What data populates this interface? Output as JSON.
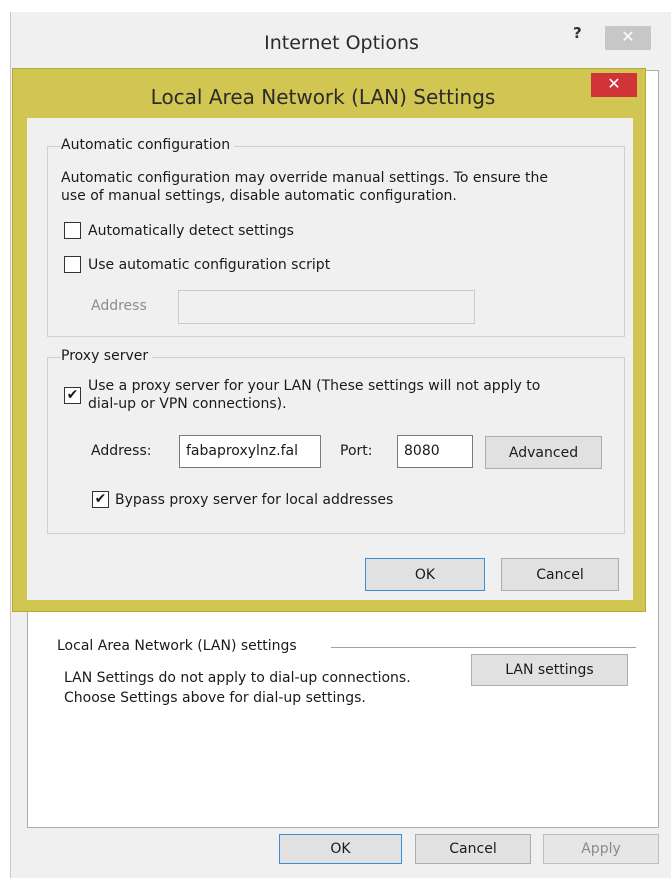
{
  "outer_window": {
    "title": "Internet Options",
    "help_label": "?",
    "close_glyph": "✕",
    "lan_group_label": "Local Area Network (LAN) settings",
    "lan_desc_line1": "LAN Settings do not apply to dial-up connections.",
    "lan_desc_line2": "Choose Settings above for dial-up settings.",
    "lan_settings_button": "LAN settings",
    "ok_button": "OK",
    "cancel_button": "Cancel",
    "apply_button": "Apply"
  },
  "lan_dialog": {
    "title": "Local Area Network (LAN) Settings",
    "close_glyph": "✕",
    "accent_color": "#d2c652",
    "automatic": {
      "group_label": "Automatic configuration",
      "description_line1": "Automatic configuration may override manual settings.  To ensure the",
      "description_line2": "use of manual settings, disable automatic configuration.",
      "detect_label": "Automatically detect settings",
      "detect_checked": false,
      "script_label": "Use automatic configuration script",
      "script_checked": false,
      "address_label": "Address",
      "address_value": ""
    },
    "proxy": {
      "group_label": "Proxy server",
      "use_proxy_label_line1": "Use a proxy server for your LAN (These settings will not apply to",
      "use_proxy_label_line2": "dial-up or VPN connections).",
      "use_proxy_checked": true,
      "address_label": "Address:",
      "address_value": "fabaproxylnz.fal",
      "port_label": "Port:",
      "port_value": "8080",
      "advanced_button": "Advanced",
      "bypass_label": "Bypass proxy server for local addresses",
      "bypass_checked": true
    },
    "ok_button": "OK",
    "cancel_button": "Cancel",
    "check_glyph": "✔"
  }
}
